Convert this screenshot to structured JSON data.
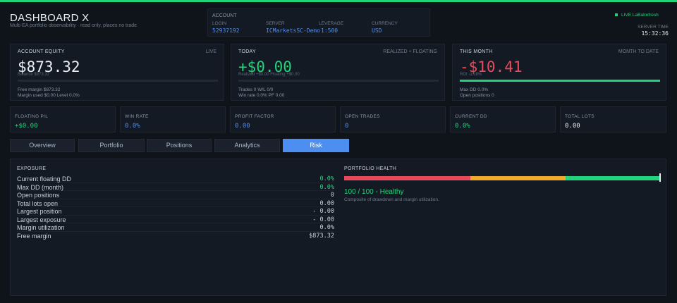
{
  "colors": {
    "accent": "#1fd47a",
    "blue": "#4d8ff0",
    "red": "#e94a5a",
    "amber": "#f0a929"
  },
  "header": {
    "title": "DASHBOARD X",
    "subtitle": "Multi-EA portfolio observability  ·  read only, places no trade",
    "account": {
      "heading": "ACCOUNT",
      "login_label": "LOGIN",
      "login": "52937192",
      "server_label": "SERVER",
      "server": "ICMarketsSC-Demo",
      "leverage_label": "LEVERAGE",
      "leverage": "1:500",
      "currency_label": "CURRENCY",
      "currency": "USD"
    },
    "live_label": "LIVE  LaBalrefresh",
    "server_time_label": "SERVER TIME",
    "server_time": "15:32:36"
  },
  "cards": {
    "equity": {
      "title": "ACCOUNT EQUITY",
      "tag": "LIVE",
      "value": "$873.32",
      "ghost": "Balance $873.32",
      "bar_fill": 0,
      "line1": "Free margin  $873.32",
      "line2": "Margin used  $0.00   Level  0.0%"
    },
    "today": {
      "title": "TODAY",
      "tag": "REALIZED + FLOATING",
      "value": "+$0.00",
      "ghost": "Realized +$0.00   Floating +$0.00",
      "bar_fill": 0,
      "line1": "Trades  0   W/L  0/0",
      "line2": "Win rate  0.0%   PF  0.00"
    },
    "month": {
      "title": "THIS MONTH",
      "tag": "MONTH TO DATE",
      "value": "-$10.41",
      "ghost": "ROI  -1.18%",
      "bar_fill": 1,
      "line1": "Max DD  0.0%",
      "line2": "Open positions  0"
    }
  },
  "stats": [
    {
      "label": "FLOATING P/L",
      "value": "+$0.00"
    },
    {
      "label": "WIN RATE",
      "value": "0.0%"
    },
    {
      "label": "PROFIT FACTOR",
      "value": "0.00"
    },
    {
      "label": "OPEN TRADES",
      "value": "0"
    },
    {
      "label": "CURRENT DD",
      "value": "0.0%"
    },
    {
      "label": "TOTAL LOTS",
      "value": "0.00"
    }
  ],
  "tabs": [
    {
      "label": "Overview"
    },
    {
      "label": "Portfolio"
    },
    {
      "label": "Positions"
    },
    {
      "label": "Analytics"
    },
    {
      "label": "Risk",
      "active": true
    }
  ],
  "risk": {
    "exposure_title": "EXPOSURE",
    "rows": [
      {
        "label": "Current floating DD",
        "value": "0.0%"
      },
      {
        "label": "Max DD (month)",
        "value": "0.0%"
      },
      {
        "label": "Open positions",
        "value": "0"
      },
      {
        "label": "Total lots open",
        "value": "0.00"
      },
      {
        "label": "Largest position",
        "value": "-  0.00"
      },
      {
        "label": "Largest exposure",
        "value": "-  0.00"
      },
      {
        "label": "Margin utilization",
        "value": "0.0%"
      },
      {
        "label": "Free margin",
        "value": "$873.32"
      }
    ],
    "health_title": "PORTFOLIO HEALTH",
    "health_score": 1.0,
    "health_value": "100 / 100  -  Healthy",
    "health_sub": "Composite of drawdown and margin utilization."
  }
}
